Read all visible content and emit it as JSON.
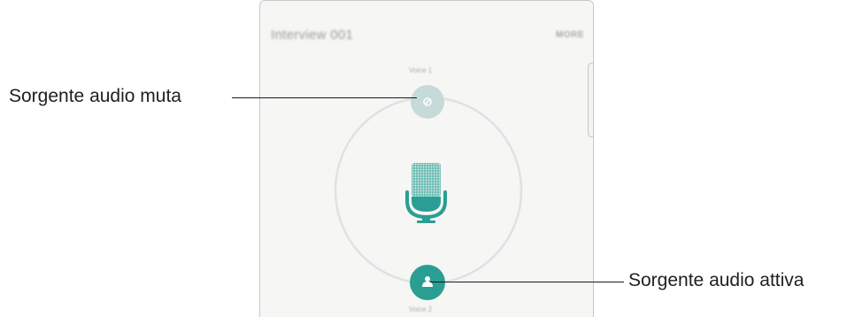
{
  "app": {
    "title": "Interview 001",
    "more_label": "MORE"
  },
  "speakers": [
    {
      "label": "Voice 1",
      "state": "muted",
      "icon": "mute-icon",
      "color": "#c5dad9"
    },
    {
      "label": "Voice 2",
      "state": "active",
      "icon": "person-icon",
      "color": "#2a9e92"
    }
  ],
  "center_icon": "microphone-icon",
  "colors": {
    "accent": "#2a9e92",
    "muted_circle": "#c5dad9",
    "ring": "#dde3e2"
  },
  "callouts": {
    "muted": "Sorgente audio muta",
    "active": "Sorgente audio attiva"
  }
}
